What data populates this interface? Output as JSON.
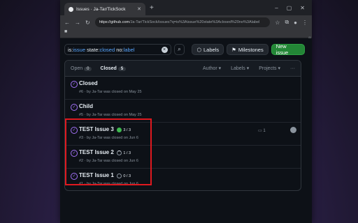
{
  "browser": {
    "tab_title": "Issues · Ja-Tar/TickSock",
    "url_host": "https://github.com",
    "url_path": "/Ja-Tar/TickSock/issues?q=is%3Aissue%20state%3Aclosed%20no%3Alabel",
    "bookmark": "■"
  },
  "toolbar": {
    "query_is": "is:",
    "query_issue": "issue",
    "query_state": " state:",
    "query_closed": "closed",
    "query_no": " no:",
    "query_label": "label",
    "labels_btn": "Labels",
    "milestones_btn": "Milestones",
    "new_issue_btn": "New issue"
  },
  "list_header": {
    "open_label": "Open",
    "open_count": "0",
    "closed_label": "Closed",
    "closed_count": "5",
    "filter_author": "Author",
    "filter_labels": "Labels",
    "filter_projects": "Projects",
    "more": "···"
  },
  "issues": [
    {
      "title": "Closed",
      "meta": "#6 · by Ja-Tar was closed on May 25",
      "tasks": ""
    },
    {
      "title": "Child",
      "meta": "#5 · by Ja-Tar was closed on May 25",
      "tasks": ""
    },
    {
      "title": "TEST Issue 3",
      "meta": "#3 · by Ja-Tar was closed on Jun 6",
      "tasks": "3 / 3",
      "comments": "1"
    },
    {
      "title": "TEST Issue 2",
      "meta": "#2 · by Ja-Tar was closed on Jun 6",
      "tasks": "1 / 3"
    },
    {
      "title": "TEST Issue 1",
      "meta": "#1 · by Ja-Tar was closed on Jun 6",
      "tasks": "0 / 3"
    }
  ],
  "colors": {
    "accent": "#a371f7",
    "primary_button": "#238636",
    "highlight": "#e0191f"
  }
}
